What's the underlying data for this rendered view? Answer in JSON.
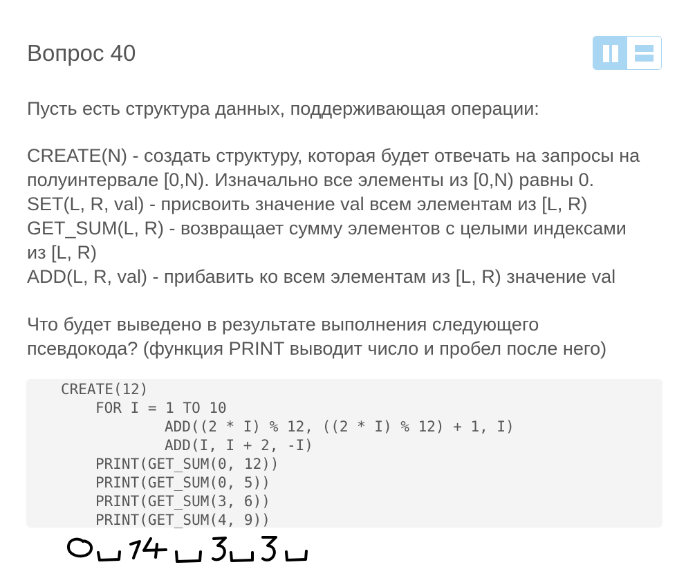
{
  "question": {
    "title": "Вопрос 40"
  },
  "paragraphs": {
    "intro": "Пусть есть структура данных, поддерживающая операции:",
    "ops": [
      "CREATE(N) - создать структуру, которая будет отвечать на запросы на",
      "полуинтервале [0,N). Изначально все элементы из [0,N) равны 0.",
      "SET(L, R, val) - присвоить значение val всем элементам из [L, R)",
      "GET_SUM(L, R) - возвращает сумму элементов с целыми индексами",
      "из [L, R)",
      "ADD(L, R, val) - прибавить ко всем элементам из [L, R) значение val"
    ],
    "question": [
      "Что будет выведено в результате выполнения следующего",
      "псевдокода? (функция PRINT выводит число и пробел после него)"
    ]
  },
  "code": [
    "CREATE(12)",
    "FOR I = 1 TO 10",
    "ADD((2 * I) % 12, ((2 * I) % 12) + 1, I)",
    "ADD(I, I + 2, -I)",
    "PRINT(GET_SUM(0, 12))",
    "PRINT(GET_SUM(0, 5))",
    "PRINT(GET_SUM(3, 6))",
    "PRINT(GET_SUM(4, 9))"
  ],
  "handwritten_answer": {
    "values": [
      "0",
      "14",
      "3",
      "3"
    ]
  },
  "colors": {
    "text": "#555555",
    "toggle_accent": "#a9d6f2",
    "code_background": "#f4f4f4",
    "ink": "#000000"
  },
  "icons": {
    "layout_columns": "two-column-layout-icon",
    "layout_rows": "two-row-layout-icon"
  }
}
